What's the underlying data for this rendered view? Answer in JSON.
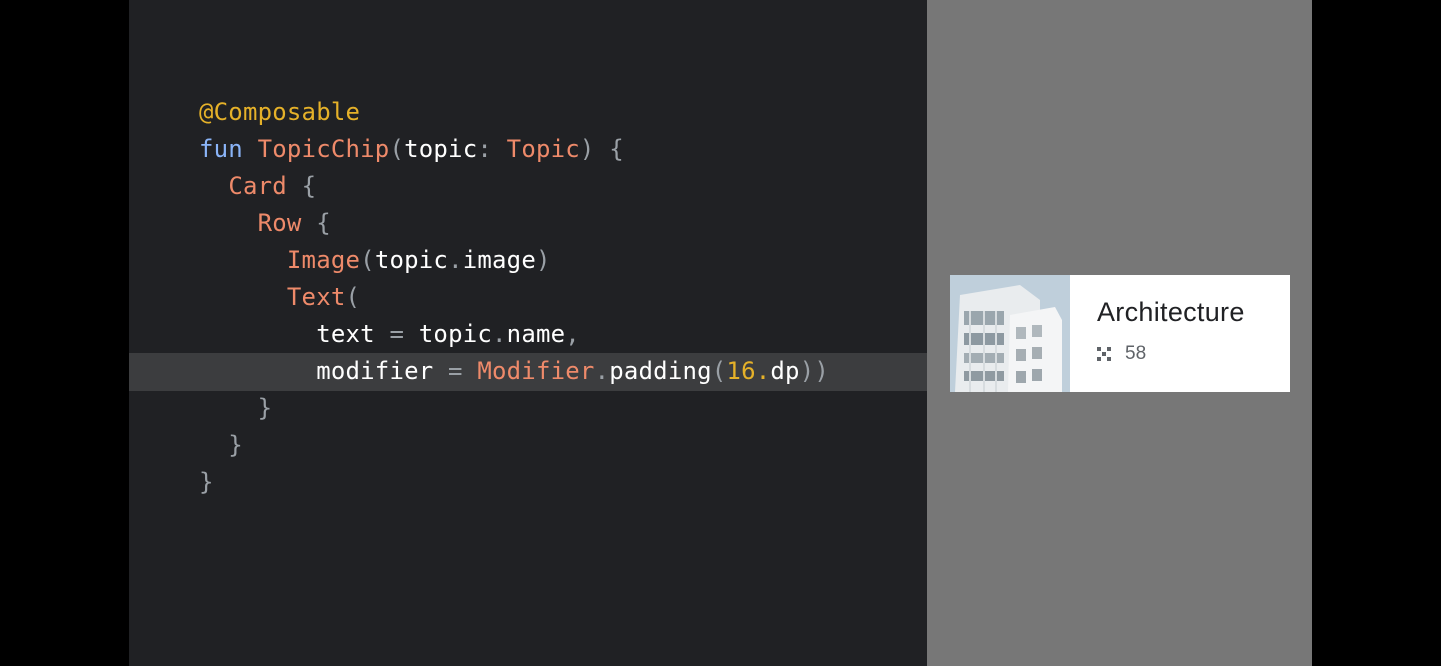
{
  "code": {
    "lines": [
      [
        {
          "t": "@Composable",
          "c": "annotation"
        }
      ],
      [
        {
          "t": "fun ",
          "c": "keyword"
        },
        {
          "t": "TopicChip",
          "c": "type"
        },
        {
          "t": "(",
          "c": "punct"
        },
        {
          "t": "topic",
          "c": "ident"
        },
        {
          "t": ": ",
          "c": "punct"
        },
        {
          "t": "Topic",
          "c": "type"
        },
        {
          "t": ") {",
          "c": "punct"
        }
      ],
      [
        {
          "t": "  ",
          "c": "ident"
        },
        {
          "t": "Card",
          "c": "type"
        },
        {
          "t": " {",
          "c": "punct"
        }
      ],
      [
        {
          "t": "    ",
          "c": "ident"
        },
        {
          "t": "Row",
          "c": "type"
        },
        {
          "t": " {",
          "c": "punct"
        }
      ],
      [
        {
          "t": "      ",
          "c": "ident"
        },
        {
          "t": "Image",
          "c": "type"
        },
        {
          "t": "(",
          "c": "punct"
        },
        {
          "t": "topic",
          "c": "ident"
        },
        {
          "t": ".",
          "c": "punct"
        },
        {
          "t": "image",
          "c": "ident"
        },
        {
          "t": ")",
          "c": "punct"
        }
      ],
      [
        {
          "t": "      ",
          "c": "ident"
        },
        {
          "t": "Text",
          "c": "type"
        },
        {
          "t": "(",
          "c": "punct"
        }
      ],
      [
        {
          "t": "        ",
          "c": "ident"
        },
        {
          "t": "text",
          "c": "ident"
        },
        {
          "t": " = ",
          "c": "punct"
        },
        {
          "t": "topic",
          "c": "ident"
        },
        {
          "t": ".",
          "c": "punct"
        },
        {
          "t": "name",
          "c": "ident"
        },
        {
          "t": ",",
          "c": "punct"
        }
      ],
      [
        {
          "t": "        ",
          "c": "ident"
        },
        {
          "t": "modifier",
          "c": "ident"
        },
        {
          "t": " = ",
          "c": "punct"
        },
        {
          "t": "Modifier",
          "c": "type"
        },
        {
          "t": ".",
          "c": "punct"
        },
        {
          "t": "padding",
          "c": "ident"
        },
        {
          "t": "(",
          "c": "punct"
        },
        {
          "t": "16.",
          "c": "number"
        },
        {
          "t": "dp",
          "c": "ident"
        },
        {
          "t": "))",
          "c": "punct"
        }
      ],
      [
        {
          "t": "    }",
          "c": "punct"
        }
      ],
      [
        {
          "t": "  }",
          "c": "punct"
        }
      ],
      [
        {
          "t": "}",
          "c": "punct"
        }
      ]
    ],
    "highlighted_line": 7
  },
  "preview": {
    "topic_chip": {
      "name": "Architecture",
      "count": "58",
      "icon": "grid-dots-icon"
    }
  },
  "colors": {
    "code_background": "#202124",
    "preview_background": "#777777",
    "highlight_line": "#3c3d3f",
    "annotation": "#e5b129",
    "keyword": "#8ab4f8",
    "type": "#ee8a6a",
    "identifier": "#ffffff",
    "punctuation": "#9aa0a6"
  }
}
